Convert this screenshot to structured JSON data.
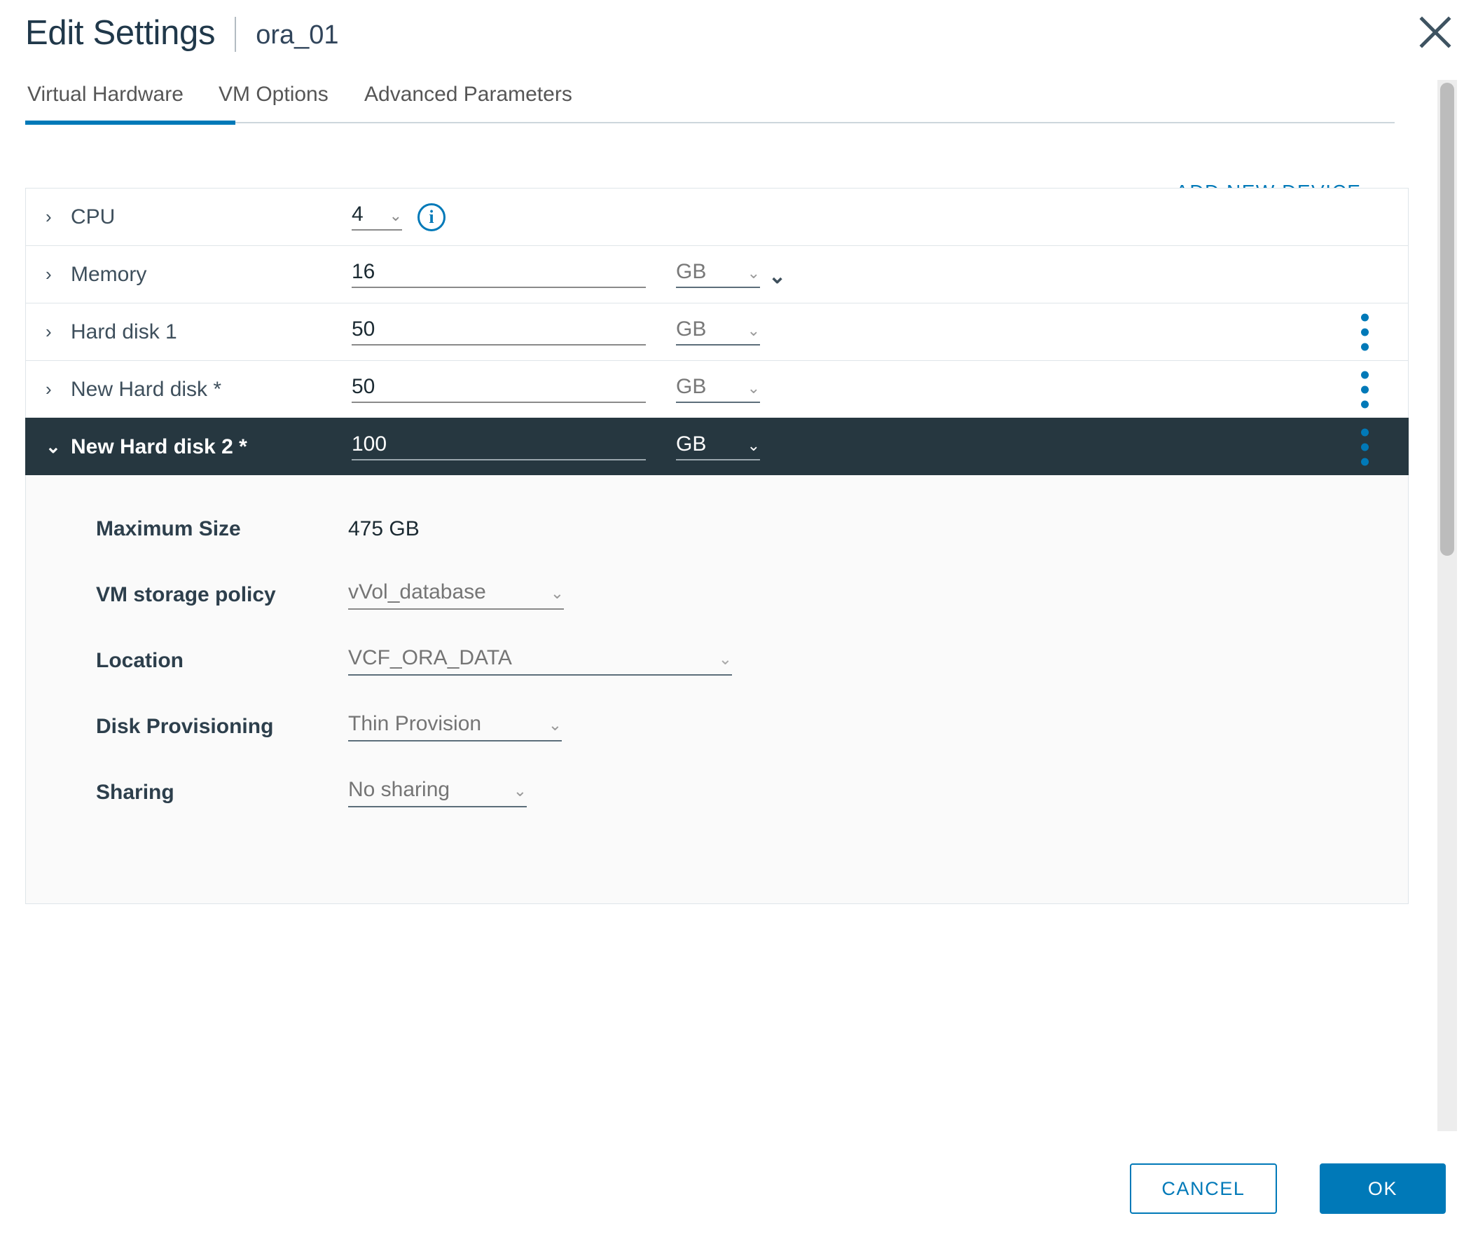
{
  "header": {
    "title": "Edit Settings",
    "vm_name": "ora_01",
    "close_icon": "close-icon"
  },
  "tabs": [
    {
      "label": "Virtual Hardware",
      "active": true
    },
    {
      "label": "VM Options",
      "active": false
    },
    {
      "label": "Advanced Parameters",
      "active": false
    }
  ],
  "toolbar": {
    "add_new_device": "ADD NEW DEVICE",
    "add_new_device_chevron": "⌄"
  },
  "devices": [
    {
      "name": "CPU",
      "caret": "›",
      "value": "4",
      "value_chevron": "⌄",
      "info_glyph": "i",
      "has_info": true,
      "selected": false
    },
    {
      "name": "Memory",
      "caret": "›",
      "value": "16",
      "unit": "GB",
      "unit_chevron": "⌄",
      "dropdown_chevron": "⌄",
      "selected": false
    },
    {
      "name": "Hard disk 1",
      "caret": "›",
      "value": "50",
      "unit": "GB",
      "unit_chevron": "⌄",
      "selected": false
    },
    {
      "name": "New Hard disk *",
      "caret": "›",
      "value": "50",
      "unit": "GB",
      "unit_chevron": "⌄",
      "selected": false
    },
    {
      "name": "New Hard disk 2 *",
      "caret": "⌄",
      "value": "100",
      "unit": "GB",
      "unit_chevron": "⌄",
      "selected": true
    }
  ],
  "detail": {
    "max_size_label": "Maximum Size",
    "max_size_value": "475 GB",
    "storage_policy_label": "VM storage policy",
    "storage_policy_value": "vVol_database",
    "location_label": "Location",
    "location_value": "VCF_ORA_DATA",
    "provisioning_label": "Disk Provisioning",
    "provisioning_value": "Thin Provision",
    "sharing_label": "Sharing",
    "sharing_value": "No sharing",
    "chevron": "⌄"
  },
  "footer": {
    "cancel": "CANCEL",
    "ok": "OK"
  },
  "colors": {
    "accent": "#0079b8",
    "selected_row": "#263740",
    "title": "#20384a",
    "panel_bg": "#fafafa",
    "border": "#dfe5e9"
  }
}
